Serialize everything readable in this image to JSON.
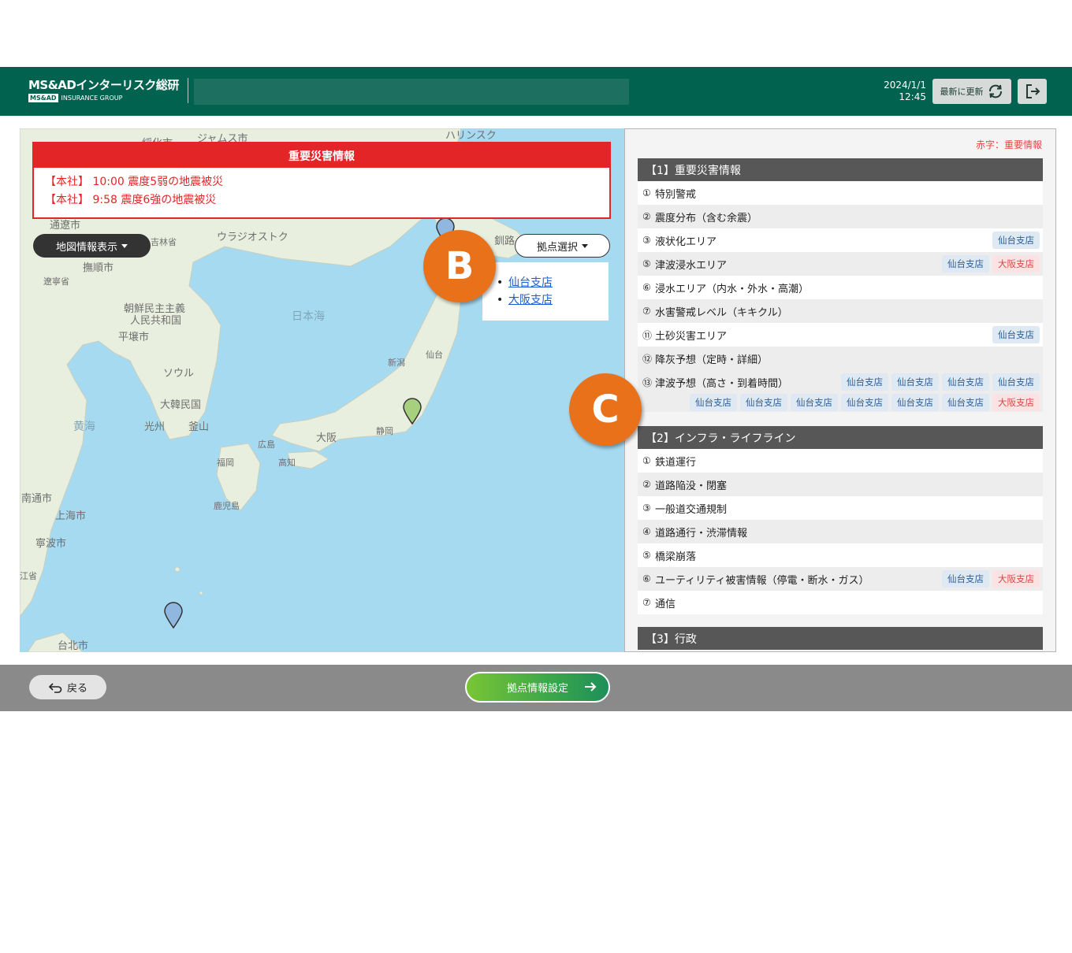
{
  "header": {
    "logo_main": "MS&ADインターリスク総研",
    "logo_badge": "MS&AD",
    "logo_group": "INSURANCE GROUP",
    "date": "2024/1/1",
    "time": "12:45",
    "refresh_label": "最新に更新"
  },
  "alert": {
    "title": "重要災害情報",
    "lines": [
      "【本社】 10:00 震度5弱の地震被災",
      "【本社】 9:58 震度6強の地震被災"
    ]
  },
  "map": {
    "info_button": "地図情報表示",
    "site_select_button": "拠点選択",
    "sites": [
      "仙台支店",
      "大阪支店"
    ],
    "labels": {
      "jamusu": "ジャムス市",
      "harinsku": "ハリンスク",
      "suika": "綏化市",
      "tsuuka": "通遼市",
      "kichirin": "吉林省",
      "vladivostok": "ウラジオストク",
      "bujun": "撫順市",
      "ryouneishou": "遼寧省",
      "kushiro": "釧路",
      "nk": "朝鮮民主主義",
      "nk2": "人民共和国",
      "sea_of_japan": "日本海",
      "pyongyang": "平壌市",
      "sendai": "仙台",
      "niigata": "新潟",
      "seoul": "ソウル",
      "korea": "大韓民国",
      "yellow_sea": "黄海",
      "gwangju": "光州",
      "busan": "釜山",
      "osaka": "大阪",
      "shizuoka": "静岡",
      "hiroshima": "広島",
      "fukuoka": "福岡",
      "kochi": "高知",
      "kagoshima": "鹿児島",
      "nantong": "南通市",
      "shanghai": "上海市",
      "ningbo": "寧波市",
      "zhejiang": "江省",
      "taipei": "台北市"
    },
    "marker_b": "B",
    "marker_c": "C"
  },
  "panel": {
    "legend": "赤字：重要情報",
    "section1": "【1】重要災害情報",
    "section2": "【2】インフラ・ライフライン",
    "section3": "【3】行政",
    "s1": [
      {
        "num": "①",
        "label": "特別警戒"
      },
      {
        "num": "②",
        "label": "震度分布（含む余震）"
      },
      {
        "num": "③",
        "label": "液状化エリア"
      },
      {
        "num": "⑤",
        "label": "津波浸水エリア"
      },
      {
        "num": "⑥",
        "label": "浸水エリア（内水・外水・高潮）"
      },
      {
        "num": "⑦",
        "label": "水害警戒レベル（キキクル）"
      },
      {
        "num": "⑪",
        "label": "土砂災害エリア"
      },
      {
        "num": "⑫",
        "label": "降灰予想（定時・詳細）"
      },
      {
        "num": "⑬",
        "label": "津波予想（高さ・到着時間）"
      }
    ],
    "s2": [
      {
        "num": "①",
        "label": "鉄道運行"
      },
      {
        "num": "②",
        "label": "道路陥没・閉塞"
      },
      {
        "num": "③",
        "label": "一般道交通規制"
      },
      {
        "num": "④",
        "label": "道路通行・渋滞情報"
      },
      {
        "num": "⑤",
        "label": "橋梁崩落"
      },
      {
        "num": "⑥",
        "label": "ユーティリティ被害情報（停電・断水・ガス）"
      },
      {
        "num": "⑦",
        "label": "通信"
      }
    ],
    "tag_sendai": "仙台支店",
    "tag_osaka": "大阪支店"
  },
  "footer": {
    "back": "戻る",
    "settings": "拠点情報設定"
  },
  "colors": {
    "header": "#00624f",
    "alert_red": "#e32527",
    "marker_orange": "#e8711a",
    "map_sea": "#a6daf0"
  }
}
